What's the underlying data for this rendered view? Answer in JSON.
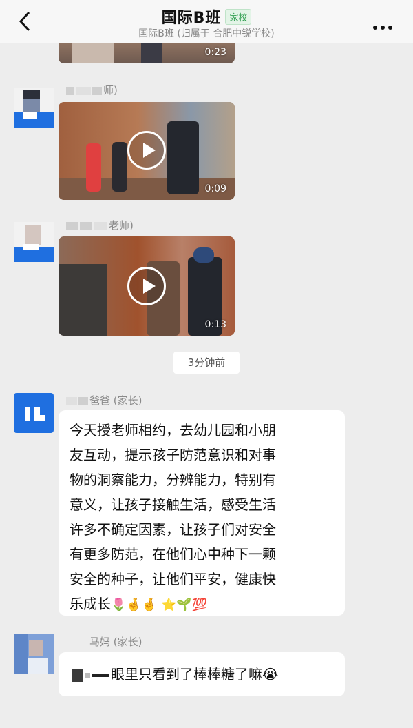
{
  "header": {
    "title": "国际B班",
    "badge": "家校",
    "subtitle": "国际B班 (归属于 合肥中锐学校)"
  },
  "messages": [
    {
      "type": "video",
      "duration": "0:23"
    },
    {
      "type": "video",
      "sender": "师)",
      "duration": "0:09"
    },
    {
      "type": "video",
      "sender": "老师)",
      "duration": "0:13"
    }
  ],
  "time_divider": "3分钟前",
  "text_message_1": {
    "sender": "爸爸 (家长)",
    "lines": [
      "今天授老师相约，去幼儿园和小朋",
      "友互动，提示孩子防范意识和对事",
      "物的洞察能力，分辨能力，特别有",
      "意义，让孩子接触生活，感受生活",
      "许多不确定因素，让孩子们对安全",
      "有更多防范，在他们心中种下一颗",
      "安全的种子，让他们平安，健康快",
      "乐成长"
    ],
    "emojis": "🌷🤞🤞 ⭐🌱💯"
  },
  "text_message_2": {
    "sender": "马妈 (家长)",
    "text": "眼里只看到了棒棒糖了嘛😭"
  }
}
